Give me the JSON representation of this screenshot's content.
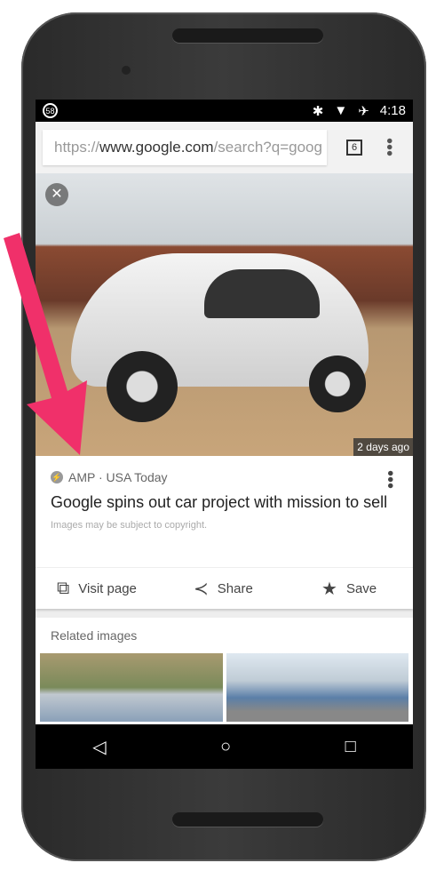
{
  "status_bar": {
    "notification": "58",
    "time": "4:18",
    "icons": [
      "bluetooth-icon",
      "wifi-icon",
      "airplane-icon"
    ]
  },
  "browser": {
    "url_scheme": "https://",
    "url_host": "www.google.com",
    "url_path": "/search?q=goog",
    "tab_count": "6"
  },
  "image": {
    "age": "2 days ago"
  },
  "result": {
    "source": "AMP · USA Today",
    "title": "Google spins out car project with mission to sell",
    "copyright": "Images may be subject to copyright."
  },
  "actions": {
    "visit": "Visit page",
    "share": "Share",
    "save": "Save"
  },
  "related": {
    "heading": "Related images"
  },
  "annotation": {
    "arrow_color": "#f0306a"
  }
}
